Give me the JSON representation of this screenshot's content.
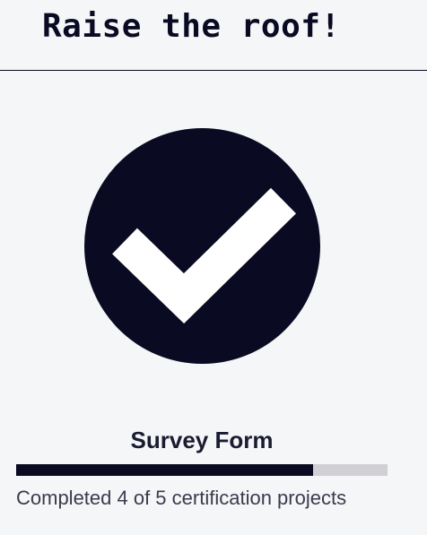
{
  "header": {
    "headline": "Raise the roof!"
  },
  "badge": {
    "icon": "checkmark-circle-icon",
    "circle_color": "#0a0a23",
    "check_color": "#ffffff"
  },
  "project": {
    "title": "Survey Form",
    "progress": {
      "completed": 4,
      "total": 5,
      "text": "Completed 4 of 5 certification projects"
    }
  },
  "colors": {
    "background": "#f5f6f7",
    "primary": "#0a0a23",
    "track": "#d0d0d5"
  }
}
